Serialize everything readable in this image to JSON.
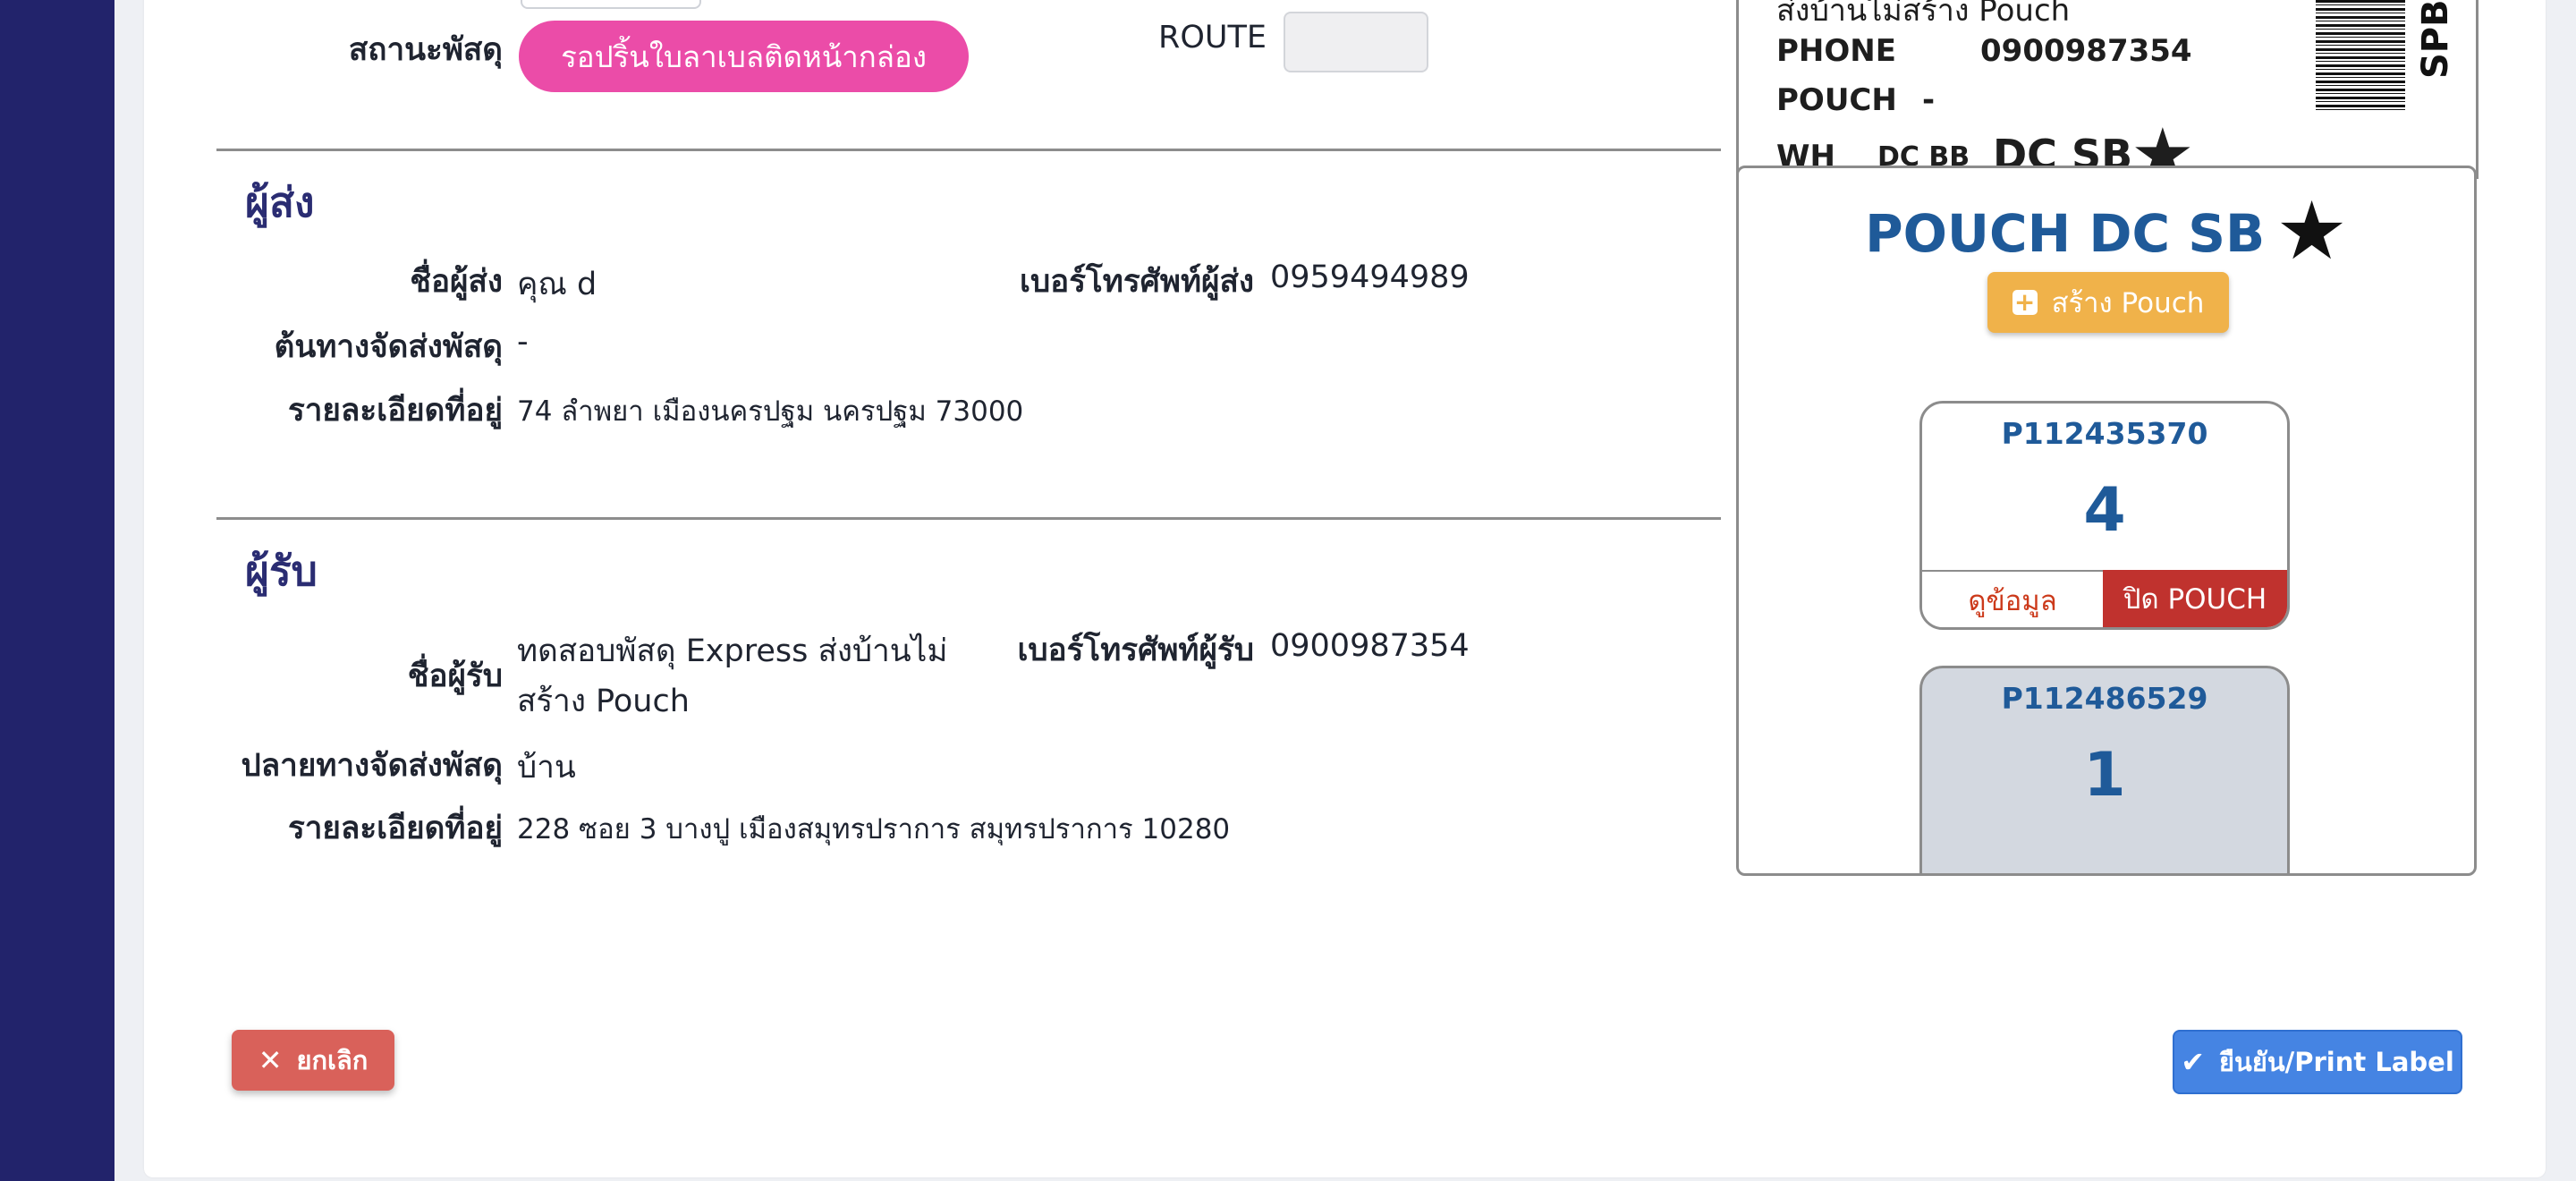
{
  "shipment": {
    "status_label": "สถานะพัสดุ",
    "status_value": "รอปริ้นใบลาเบลติดหน้ากล่อง",
    "route_label": "ROUTE",
    "route_value": ""
  },
  "sender": {
    "section_title": "ผู้ส่ง",
    "name_label": "ชื่อผู้ส่ง",
    "name_value": "คุณ d",
    "phone_label": "เบอร์โทรศัพท์ผู้ส่ง",
    "phone_value": "0959494989",
    "origin_label": "ต้นทางจัดส่งพัสดุ",
    "origin_value": "-",
    "address_label": "รายละเอียดที่อยู่",
    "address_value": "74 ลำพยา เมืองนครปฐม นครปฐม 73000"
  },
  "receiver": {
    "section_title": "ผู้รับ",
    "name_label": "ชื่อผู้รับ",
    "name_line1": "ทดสอบพัสดุ Express ส่งบ้านไม่",
    "name_line2": "สร้าง Pouch",
    "phone_label": "เบอร์โทรศัพท์ผู้รับ",
    "phone_value": "0900987354",
    "destination_label": "ปลายทางจัดส่งพัสดุ",
    "destination_value": "บ้าน",
    "address_label": "รายละเอียดที่อยู่",
    "address_value": "228 ซอย 3 บางปู เมืองสมุทรปราการ สมุทรปราการ 10280"
  },
  "label_preview": {
    "line_name": "ส่งบ้านไม่สร้าง Pouch",
    "phone_key": "PHONE",
    "phone_value": "0900987354",
    "pouch_key": "POUCH",
    "pouch_value": "-",
    "wh_key": "WH",
    "wh_value": "DC BB",
    "dc_value": "DC SB",
    "star": "★",
    "side_code": "SPBD"
  },
  "pouch_panel": {
    "title": "POUCH DC SB",
    "star": "★",
    "create_label": "สร้าง Pouch",
    "cards": [
      {
        "id": "P112435370",
        "count": "4",
        "view_label": "ดูข้อมูล",
        "close_label": "ปิด POUCH"
      },
      {
        "id": "P112486529",
        "count": "1"
      }
    ]
  },
  "actions": {
    "cancel_label": "ยกเลิก",
    "confirm_label": "ยืนยัน/Print Label"
  },
  "colors": {
    "sidebar": "#22236b",
    "status_pill": "#eb4ca8",
    "pouch_title": "#1f5a99",
    "create_button": "#f0b24a",
    "close_pouch": "#c0322e",
    "cancel_button": "#d9615a",
    "confirm_button": "#4584e3"
  }
}
